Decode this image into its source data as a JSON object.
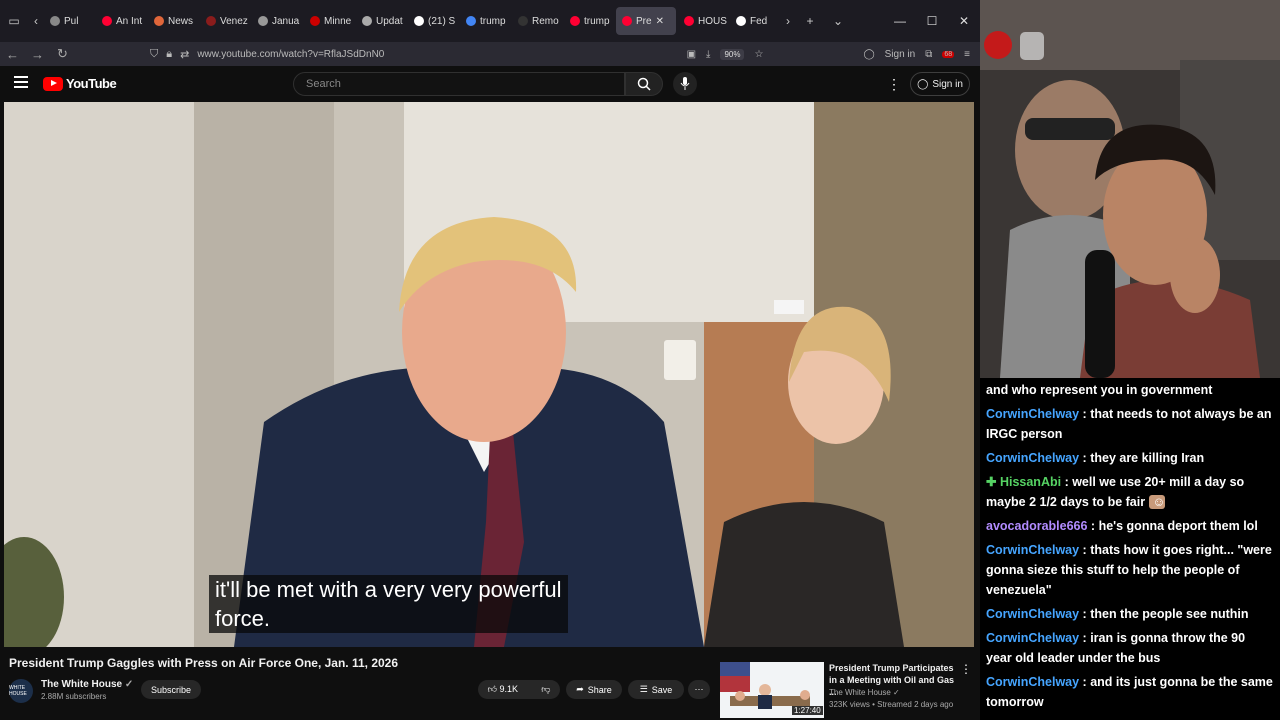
{
  "browser": {
    "tabs": [
      {
        "label": "Pul",
        "fav": "#888888"
      },
      {
        "label": "An Int",
        "fav": "#ff0033"
      },
      {
        "label": "News",
        "fav": "#e0663a"
      },
      {
        "label": "Venez",
        "fav": "#8a1c1c"
      },
      {
        "label": "Janua",
        "fav": "#999999"
      },
      {
        "label": "Minne",
        "fav": "#cc0000"
      },
      {
        "label": "Updat",
        "fav": "#aaaaaa"
      },
      {
        "label": "(21) S",
        "fav": "#ffffff"
      },
      {
        "label": "trump",
        "fav": "#4285f4"
      },
      {
        "label": "Remo",
        "fav": "#333333"
      },
      {
        "label": "trump",
        "fav": "#ff0033"
      },
      {
        "label": "Pre",
        "fav": "#ff0033",
        "active": true
      },
      {
        "label": "HOUS",
        "fav": "#ff0033"
      },
      {
        "label": "Fed",
        "fav": "#ffffff"
      }
    ],
    "url": "www.youtube.com/watch?v=RflaJSdDnN0",
    "zoom": "90%",
    "sign_in": "Sign in",
    "ext_badge": "68"
  },
  "youtube": {
    "logo_text": "YouTube",
    "search_placeholder": "Search",
    "sign_in": "Sign in",
    "caption": "it'll be met with a very very powerful\nforce.",
    "video_title": "President Trump Gaggles with Press on Air Force One, Jan. 11, 2026",
    "channel_name": "The White House",
    "channel_avatar_text": "WHITE HOUSE",
    "subscribers": "2.88M subscribers",
    "subscribe_label": "Subscribe",
    "likes": "9.1K",
    "share_label": "Share",
    "save_label": "Save",
    "recommended": {
      "title": "President Trump Participates in a Meeting with Oil and Gas ...",
      "channel": "The White House",
      "stats": "323K views • Streamed 2 days ago",
      "duration": "1:27:40"
    }
  },
  "chat": [
    {
      "user": "",
      "text": "and who represent you in government"
    },
    {
      "user": "CorwinChelway",
      "text": "that needs to not always be an IRGC person",
      "color": "blue"
    },
    {
      "user": "CorwinChelway",
      "text": "they are killing Iran",
      "color": "blue"
    },
    {
      "user": "HissanAbi",
      "text": "well we use 20+ mill a day so maybe 2 1/2 days to be fair",
      "color": "green",
      "badge": true,
      "emote": true
    },
    {
      "user": "avocadorable666",
      "text": "he's gonna deport them lol",
      "color": "purple"
    },
    {
      "user": "CorwinChelway",
      "text": "thats how it goes right... \"were gonna sieze this stuff to help the people of venezuela\"",
      "color": "blue"
    },
    {
      "user": "CorwinChelway",
      "text": "then the people see nuthin",
      "color": "blue"
    },
    {
      "user": "CorwinChelway",
      "text": "iran is gonna throw the 90 year old leader under the bus",
      "color": "blue"
    },
    {
      "user": "CorwinChelway",
      "text": "and its just gonna be the same tomorrow",
      "color": "blue"
    }
  ],
  "colors": {
    "youtube_red": "#ff0000",
    "chat_user_blue": "#46a5ff",
    "chat_user_green": "#56d364"
  }
}
